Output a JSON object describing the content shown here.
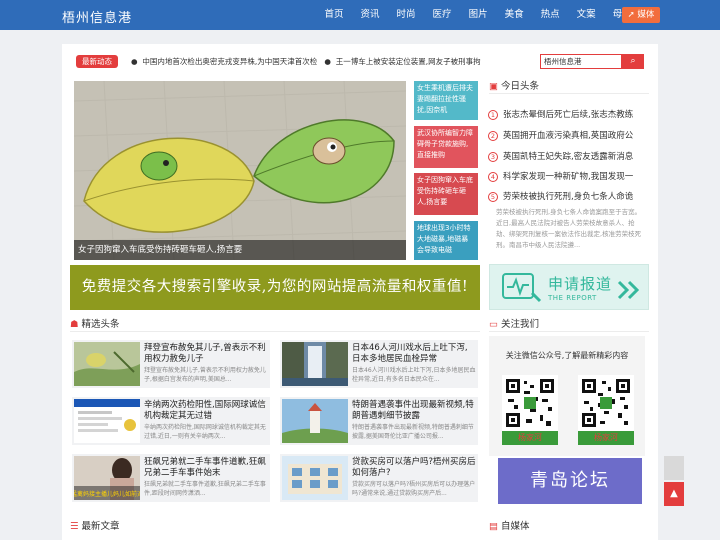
{
  "header": {
    "logo": "梧州信息港",
    "nav": [
      "首页",
      "资讯",
      "时尚",
      "医疗",
      "图片",
      "美食",
      "热点",
      "文案",
      "母婴"
    ],
    "media_button": "媒体"
  },
  "ticker": {
    "tag": "最新动态",
    "items": [
      "中国内地首次检出奥密克戎变异株,为中国天津首次检",
      "王一博车上被安装定位装置,网友子被刑事拘留"
    ]
  },
  "search": {
    "value": "梧州信息港"
  },
  "hero": {
    "caption": "女子因狗窜入车底受伤持砖砸车砸人,扬言要"
  },
  "side_cards": [
    {
      "text": "女生乘机遭后排夫妻踢翻拉扯性骚扰,因奈机",
      "color": "#53b9c9"
    },
    {
      "text": "武汉协所编智力障碍骨子贷款施购,直接推购",
      "color": "#e1545d"
    },
    {
      "text": "女子因狗窜入车底受伤持砖砸车砸人,扬言要",
      "color": "#d74a50"
    },
    {
      "text": "地球出现3小时特大地磁暴,地磁暴会导致电磁",
      "color": "#3a9fbf"
    }
  ],
  "banner": {
    "text": "免费提交各大搜索引擎收录,为您的网站提高流量和权重值!"
  },
  "today": {
    "title": "今日头条",
    "items": [
      "张志杰晕倒后死亡后续,张志杰教练",
      "英国拥开血液污染真相,英国政府公",
      "英国凯特王妃失踪,密友透露新消息",
      "科学家发现一种新矿物,我国发现一",
      "劳荣枝被执行死刑,身负七条人命诡"
    ],
    "summary": "劳荣枝被执行死刑,身负七条人命诡案跑至于吉宽。近日,最高人民法院对被告人劳荣枝故意杀人、抢劫、绑架死刑复核一案依法作出裁定,核准劳荣枝死刑。南昌市中级人民法院遵..."
  },
  "report": {
    "main": "申请报道",
    "sub": "THE REPORT"
  },
  "featured": {
    "title": "精选头条",
    "cards": [
      {
        "title": "拜登宣布赦免其儿子,曾表示不利用权力赦免儿子",
        "summary": "拜登宣布赦免其儿子,曾表示不利用权力赦免儿子,根据白宫发布的声明,美国总..."
      },
      {
        "title": "日本46人河川戏水后上吐下泻,日本多地居民血栓异常",
        "summary": "日本46人河川戏水后上吐下泻,日本多地居民血栓异常,近日,有多名日本民众在..."
      },
      {
        "title": "辛纳两次药检阳性,国际网球诚信机构裁定其无过错",
        "summary": "辛纳两次药检阳性,国际网球诚信机构裁定其无过错,近日,一则有关辛纳两次..."
      },
      {
        "title": "特朗普遇袭事件出现最新视频,特朗普遇刺细节披露",
        "summary": "特朗普遇袭事件出现最新视频,特朗普遇刺细节披露,据美国哥伦比亚广播公司报..."
      },
      {
        "title": "狂飙兄弟就二手车事件道歉,狂飙兄弟二手车事件始末",
        "summary": "狂飙兄弟就二手车事件道歉,狂飙兄弟二手车事件,距段时间网传潇洒..."
      },
      {
        "title": "贷款买房可以落户吗?梧州买房后如何落户?",
        "summary": "贷款买房可以落户吗?梧州买房后可以办理落户吗?通常来说,通过贷款购买房产后..."
      }
    ],
    "thumb5_text": "为猛禽妈接主播儿妈儿如前对就"
  },
  "follow": {
    "title": "关注我们",
    "text": "关注微信公众号,了解最新精彩内容",
    "qr1": "杨家河",
    "qr2": "杨家河"
  },
  "qingdao": {
    "text": "青岛论坛"
  },
  "latest": {
    "title": "最新文章"
  },
  "selfmedia": {
    "title": "自媒体"
  }
}
